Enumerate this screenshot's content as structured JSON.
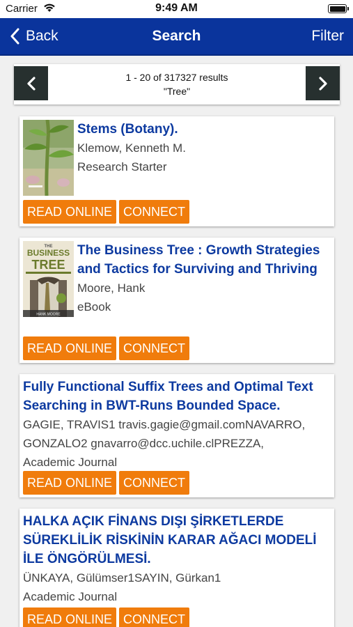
{
  "status_bar": {
    "carrier": "Carrier",
    "time": "9:49 AM"
  },
  "nav": {
    "back_label": "Back",
    "title": "Search",
    "filter_label": "Filter"
  },
  "pager": {
    "range": "1 - 20 of 317327 results",
    "query": "\"Tree\""
  },
  "buttons": {
    "read_online": "READ ONLINE",
    "connect": "CONNECT"
  },
  "results": [
    {
      "title": "Stems (Botany).",
      "authors": "Klemow, Kenneth M.",
      "type": "Research Starter"
    },
    {
      "title": "The Business Tree : Growth Strategies and Tactics for Surviving and Thriving",
      "authors": "Moore, Hank",
      "type": "eBook",
      "cover": {
        "line1": "THE",
        "line2": "BUSINESS",
        "line3": "TREE",
        "author": "HANK MOORE"
      }
    },
    {
      "title": "Fully Functional Suffix Trees and Optimal Text Searching in BWT-Runs Bounded Space.",
      "authors": "GAGIE, TRAVIS1 travis.gagie@gmail.comNAVARRO, GONZALO2 gnavarro@dcc.uchile.clPREZZA,",
      "type": "Academic Journal"
    },
    {
      "title": "HALKA AÇIK FİNANS DIŞI ŞİRKETLERDE SÜREKLİLİK RİSKİNİN KARAR AĞACI MODELİ İLE ÖNGÖRÜLMESİ.",
      "authors": "ÜNKAYA, Gülümser1SAYIN, Gürkan1",
      "type": "Academic Journal"
    }
  ]
}
